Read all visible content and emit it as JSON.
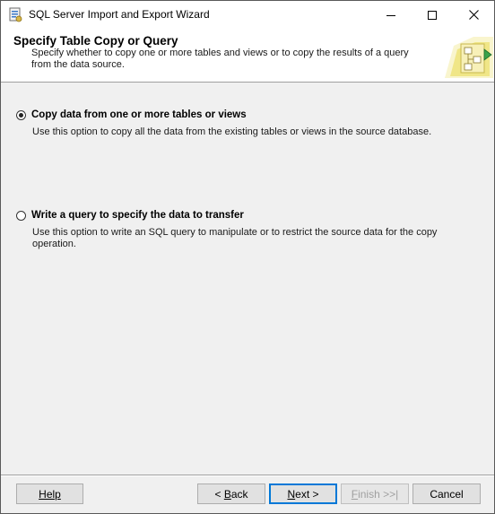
{
  "window": {
    "title": "SQL Server Import and Export Wizard",
    "icon": "wizard-app-icon"
  },
  "caption_buttons": {
    "minimize_icon": "minimize-icon",
    "maximize_icon": "maximize-icon",
    "close_icon": "close-icon"
  },
  "header": {
    "title": "Specify Table Copy or Query",
    "description": "Specify whether to copy one or more tables and views or to copy the results of a query from the data source.",
    "graphic_icon": "wizard-banner-icon"
  },
  "options": [
    {
      "label": "Copy data from one or more tables or views",
      "description": "Use this option to copy all the data from the existing tables or views in the source database.",
      "selected": true
    },
    {
      "label": "Write a query to specify the data to transfer",
      "description": "Use this option to write an SQL query to manipulate or to restrict the source data for the copy operation.",
      "selected": false
    }
  ],
  "buttons": {
    "help": "Help",
    "back_prefix": "< ",
    "back_mnemonic": "B",
    "back_rest": "ack",
    "next_mnemonic": "N",
    "next_rest": "ext >",
    "finish_mnemonic": "F",
    "finish_rest": "inish >>|",
    "cancel": "Cancel"
  },
  "colors": {
    "accent": "#0078d7",
    "disabled_text": "#a0a0a0",
    "banner_graphic": "#f2e88a"
  }
}
